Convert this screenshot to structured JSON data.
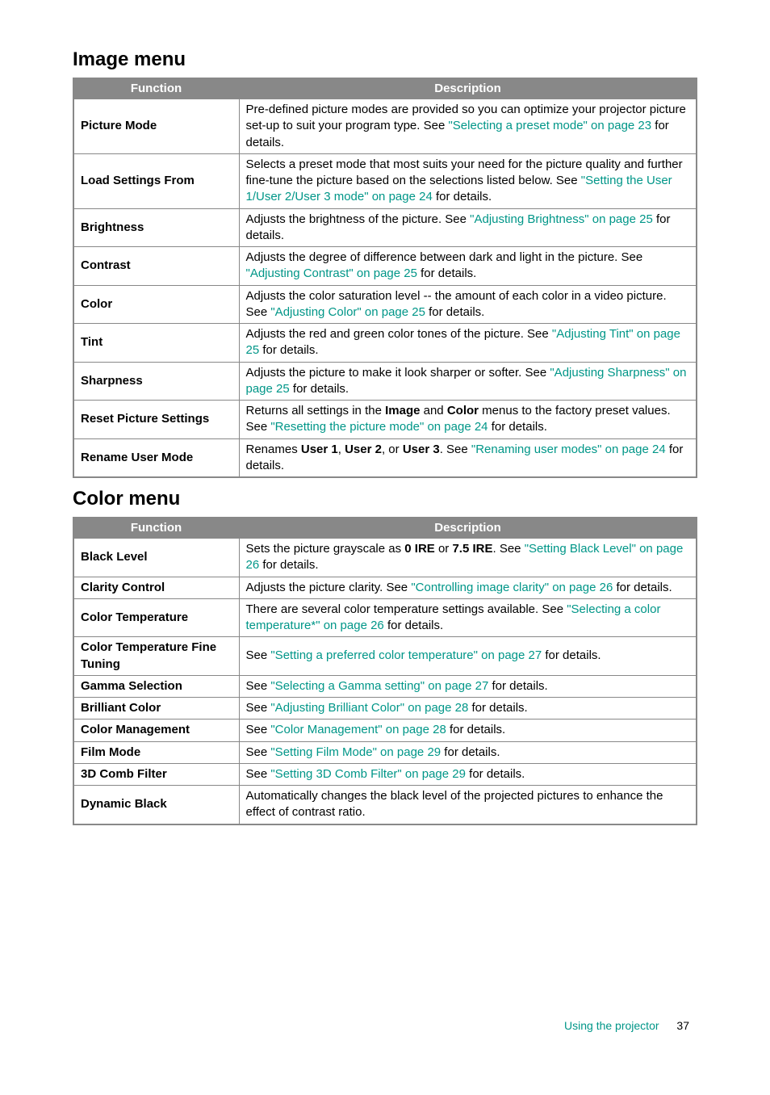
{
  "headings": {
    "image_menu": "Image menu",
    "color_menu": "Color menu"
  },
  "table_headers": {
    "function": "Function",
    "description": "Description"
  },
  "image_rows": [
    {
      "func": "Picture Mode",
      "desc_pre": "Pre-defined picture modes are provided so you can optimize your projector picture set-up to suit your program type. See ",
      "desc_link": "\"Selecting a preset mode\" on page 23",
      "desc_post": " for details."
    },
    {
      "func": "Load Settings From",
      "desc_pre": "Selects a preset mode that most suits your need for the picture quality and further fine-tune the picture based on the selections listed below. See ",
      "desc_link": "\"Setting the User 1/User 2/User 3 mode\" on page 24",
      "desc_post": " for details."
    },
    {
      "func": "Brightness",
      "desc_pre": "Adjusts the brightness of the picture. See ",
      "desc_link": "\"Adjusting Brightness\" on page 25",
      "desc_post": " for details."
    },
    {
      "func": "Contrast",
      "desc_pre": "Adjusts the degree of difference between dark and light in the picture. See ",
      "desc_link": "\"Adjusting Contrast\" on page 25",
      "desc_post": " for details."
    },
    {
      "func": "Color",
      "desc_pre": "Adjusts the color saturation level -- the amount of each color in a video picture. See ",
      "desc_link": "\"Adjusting Color\" on page 25",
      "desc_post": " for details."
    },
    {
      "func": "Tint",
      "desc_pre": "Adjusts the red and green color tones of the picture. See ",
      "desc_link": "\"Adjusting Tint\" on page 25",
      "desc_post": " for details."
    },
    {
      "func": "Sharpness",
      "desc_pre": "Adjusts the picture to make it look sharper or softer. See ",
      "desc_link": "\"Adjusting Sharpness\" on page 25",
      "desc_post": " for details."
    },
    {
      "func": "Reset Picture Settings",
      "desc_pre_a": "Returns all settings in the ",
      "bold_a": "Image",
      "mid_a": " and ",
      "bold_b": "Color",
      "desc_pre_b": " menus to the factory preset values. See ",
      "desc_link": "\"Resetting the picture mode\" on page 24",
      "desc_post": " for details."
    },
    {
      "func": "Rename User Mode",
      "desc_pre_a": "Renames ",
      "bold_a": "User 1",
      "mid_a": ", ",
      "bold_b": "User 2",
      "mid_b": ", or ",
      "bold_c": "User 3",
      "desc_pre_b": ". See ",
      "desc_link": "\"Renaming user modes\" on page 24",
      "desc_post": " for details."
    }
  ],
  "color_rows": [
    {
      "func": "Black Level",
      "desc_pre_a": "Sets the picture grayscale as ",
      "bold_a": "0 IRE",
      "mid_a": " or ",
      "bold_b": "7.5 IRE",
      "desc_pre_b": ". See ",
      "desc_link": "\"Setting Black Level\" on page 26",
      "desc_post": " for details."
    },
    {
      "func": "Clarity Control",
      "desc_pre": "Adjusts the picture clarity. See ",
      "desc_link": "\"Controlling image clarity\" on page 26",
      "desc_post": " for details."
    },
    {
      "func": "Color Temperature",
      "desc_pre": "There are several color temperature settings available. See ",
      "desc_link": "\"Selecting a color temperature*\" on page 26",
      "desc_post": " for details."
    },
    {
      "func": "Color Temperature Fine Tuning",
      "desc_pre": "See ",
      "desc_link": "\"Setting a preferred color temperature\" on page 27",
      "desc_post": " for details."
    },
    {
      "func": "Gamma Selection",
      "desc_pre": "See ",
      "desc_link": "\"Selecting a Gamma setting\" on page 27",
      "desc_post": " for details."
    },
    {
      "func": "Brilliant Color",
      "desc_pre": "See ",
      "desc_link": "\"Adjusting Brilliant Color\" on page 28",
      "desc_post": " for details."
    },
    {
      "func": "Color Management",
      "desc_pre": "See ",
      "desc_link": "\"Color Management\" on page 28",
      "desc_post": " for details."
    },
    {
      "func": "Film Mode",
      "desc_pre": "See ",
      "desc_link": "\"Setting Film Mode\" on page 29",
      "desc_post": " for details."
    },
    {
      "func": "3D Comb Filter",
      "desc_pre": "See ",
      "desc_link": "\"Setting 3D Comb Filter\" on page 29",
      "desc_post": " for details."
    },
    {
      "func": "Dynamic Black",
      "desc_plain": "Automatically changes the black level of the projected pictures to enhance the effect of contrast ratio."
    }
  ],
  "footer": {
    "section": "Using the projector",
    "page": "37"
  }
}
